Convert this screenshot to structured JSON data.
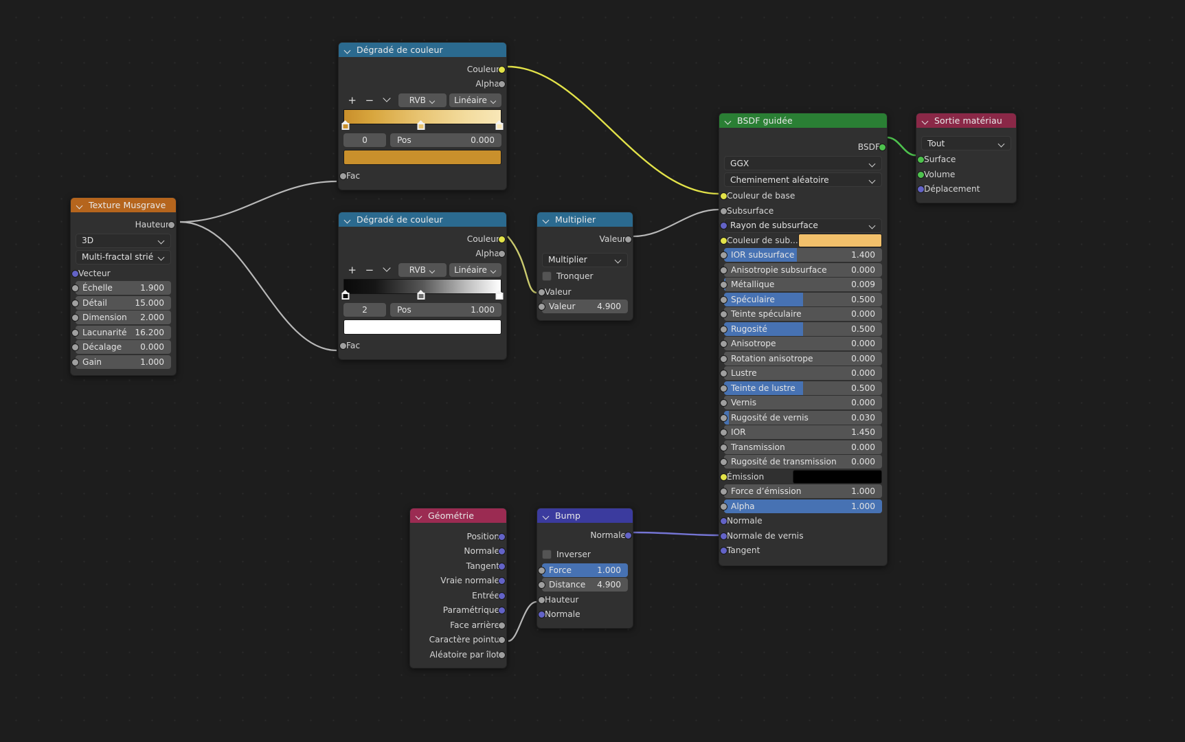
{
  "app": {
    "editor": "blender-shader-node-editor",
    "language": "fr"
  },
  "nodes": {
    "musgrave": {
      "title": "Texture Musgrave",
      "header_color": "#b5651d",
      "outputs": [
        {
          "label": "Hauteur",
          "socket": "gray"
        }
      ],
      "dropdowns": [
        "3D",
        "Multi-fractal strié"
      ],
      "vector_label": "Vecteur",
      "props": [
        {
          "label": "Échelle",
          "value": "1.900"
        },
        {
          "label": "Détail",
          "value": "15.000"
        },
        {
          "label": "Dimension",
          "value": "2.000"
        },
        {
          "label": "Lacunarité",
          "value": "16.200"
        },
        {
          "label": "Décalage",
          "value": "0.000"
        },
        {
          "label": "Gain",
          "value": "1.000"
        }
      ]
    },
    "ramp1": {
      "title": "Dégradé de couleur",
      "header_color": "#2b6a8f",
      "outputs": [
        {
          "label": "Couleur",
          "socket": "yellow"
        },
        {
          "label": "Alpha",
          "socket": "gray"
        }
      ],
      "tools": {
        "add": "+",
        "remove": "−",
        "menu": "chevron-down-icon"
      },
      "interpolation_mode": "RVB",
      "interpolation": "Linéaire",
      "gradient": "linear-gradient(to right, #c98f2b 0%, #d8a63e 18%, #e8c472 48%, #f3dc9e 78%, #f8e7b8 100%)",
      "stops": [
        {
          "pos": 0.0,
          "color": "#c98f2b",
          "selected": true
        },
        {
          "pos": 0.5,
          "color": "#e8c472",
          "selected": false
        },
        {
          "pos": 1.0,
          "color": "#f8e7b8",
          "selected": false
        }
      ],
      "index": "0",
      "pos_label": "Pos",
      "pos_value": "0.000",
      "color_value": "#c9902c",
      "inputs": [
        {
          "label": "Fac",
          "socket": "gray"
        }
      ]
    },
    "ramp2": {
      "title": "Dégradé de couleur",
      "header_color": "#2b6a8f",
      "outputs": [
        {
          "label": "Couleur",
          "socket": "yellow"
        },
        {
          "label": "Alpha",
          "socket": "gray"
        }
      ],
      "tools": {
        "add": "+",
        "remove": "−",
        "menu": "chevron-down-icon"
      },
      "interpolation_mode": "RVB",
      "interpolation": "Linéaire",
      "gradient": "linear-gradient(to right, #0a0a0a 0%, #161616 20%, #575757 50%, #bdbdbd 78%, #ffffff 100%)",
      "stops": [
        {
          "pos": 0.0,
          "color": "#0a0a0a",
          "selected": true
        },
        {
          "pos": 0.5,
          "color": "#6e6e6e",
          "selected": false
        },
        {
          "pos": 1.0,
          "color": "#ffffff",
          "selected": true
        }
      ],
      "index": "2",
      "pos_label": "Pos",
      "pos_value": "1.000",
      "color_value": "#ffffff",
      "inputs": [
        {
          "label": "Fac",
          "socket": "gray"
        }
      ]
    },
    "multiply": {
      "title": "Multiplier",
      "header_color": "#2b6a8f",
      "outputs": [
        {
          "label": "Valeur",
          "socket": "gray"
        }
      ],
      "operation": "Multiplier",
      "clamp_label": "Tronquer",
      "clamp_checked": false,
      "inputs": [
        {
          "label": "Valeur",
          "socket": "gray",
          "value": null
        },
        {
          "label": "Valeur",
          "socket": "gray",
          "value": "4.900"
        }
      ]
    },
    "bsdf": {
      "title": "BSDF guidée",
      "header_color": "#2a7f34",
      "outputs": [
        {
          "label": "BSDF",
          "socket": "green"
        }
      ],
      "dropdowns": [
        "GGX",
        "Cheminement aléatoire"
      ],
      "rows": [
        {
          "label": "Couleur de base",
          "kind": "socket-label",
          "socket": "yellow"
        },
        {
          "label": "Subsurface",
          "kind": "socket-label",
          "socket": "gray"
        },
        {
          "label": "Rayon de subsurface",
          "kind": "dropdown",
          "socket": "violet"
        },
        {
          "label": "Couleur de sub...",
          "kind": "swatch",
          "socket": "yellow",
          "color": "#f2c06b"
        },
        {
          "label": "IOR subsurface",
          "kind": "slider",
          "socket": "gray",
          "value": "1.400",
          "fill": 0.46
        },
        {
          "label": "Anisotropie subsurface",
          "kind": "slider",
          "socket": "gray",
          "value": "0.000",
          "fill": 0
        },
        {
          "label": "Métallique",
          "kind": "slider",
          "socket": "gray",
          "value": "0.009",
          "fill": 0.009
        },
        {
          "label": "Spéculaire",
          "kind": "slider",
          "socket": "gray",
          "value": "0.500",
          "fill": 0.5
        },
        {
          "label": "Teinte spéculaire",
          "kind": "slider",
          "socket": "gray",
          "value": "0.000",
          "fill": 0
        },
        {
          "label": "Rugosité",
          "kind": "slider",
          "socket": "gray",
          "value": "0.500",
          "fill": 0.5
        },
        {
          "label": "Anisotrope",
          "kind": "slider",
          "socket": "gray",
          "value": "0.000",
          "fill": 0
        },
        {
          "label": "Rotation anisotrope",
          "kind": "slider",
          "socket": "gray",
          "value": "0.000",
          "fill": 0
        },
        {
          "label": "Lustre",
          "kind": "slider",
          "socket": "gray",
          "value": "0.000",
          "fill": 0
        },
        {
          "label": "Teinte de lustre",
          "kind": "slider",
          "socket": "gray",
          "value": "0.500",
          "fill": 0.5
        },
        {
          "label": "Vernis",
          "kind": "slider",
          "socket": "gray",
          "value": "0.000",
          "fill": 0
        },
        {
          "label": "Rugosité de vernis",
          "kind": "slider",
          "socket": "gray",
          "value": "0.030",
          "fill": 0.03
        },
        {
          "label": "IOR",
          "kind": "slider",
          "socket": "gray",
          "value": "1.450",
          "fill": 0
        },
        {
          "label": "Transmission",
          "kind": "slider",
          "socket": "gray",
          "value": "0.000",
          "fill": 0
        },
        {
          "label": "Rugosité de transmission",
          "kind": "slider",
          "socket": "gray",
          "value": "0.000",
          "fill": 0
        },
        {
          "label": "Émission",
          "kind": "swatch",
          "socket": "yellow",
          "color": "#000000"
        },
        {
          "label": "Force d’émission",
          "kind": "slider",
          "socket": "gray",
          "value": "1.000",
          "fill": 0
        },
        {
          "label": "Alpha",
          "kind": "slider",
          "socket": "gray",
          "value": "1.000",
          "fill": 1
        },
        {
          "label": "Normale",
          "kind": "socket-label",
          "socket": "violet"
        },
        {
          "label": "Normale de vernis",
          "kind": "socket-label",
          "socket": "violet"
        },
        {
          "label": "Tangent",
          "kind": "socket-label",
          "socket": "violet"
        }
      ]
    },
    "output": {
      "title": "Sortie matériau",
      "header_color": "#8a2847",
      "target": "Tout",
      "inputs": [
        {
          "label": "Surface",
          "socket": "green"
        },
        {
          "label": "Volume",
          "socket": "green"
        },
        {
          "label": "Déplacement",
          "socket": "violet"
        }
      ]
    },
    "geometry": {
      "title": "Géométrie",
      "header_color": "#9b2b52",
      "outputs": [
        {
          "label": "Position",
          "socket": "violet"
        },
        {
          "label": "Normale",
          "socket": "violet"
        },
        {
          "label": "Tangent",
          "socket": "violet"
        },
        {
          "label": "Vraie normale",
          "socket": "violet"
        },
        {
          "label": "Entrée",
          "socket": "violet"
        },
        {
          "label": "Paramétrique",
          "socket": "violet"
        },
        {
          "label": "Face arrière",
          "socket": "gray"
        },
        {
          "label": "Caractère pointu",
          "socket": "gray"
        },
        {
          "label": "Aléatoire par îlot",
          "socket": "gray"
        }
      ]
    },
    "bump": {
      "title": "Bump",
      "header_color": "#3b3b9e",
      "outputs": [
        {
          "label": "Normale",
          "socket": "violet"
        }
      ],
      "invert_label": "Inverser",
      "invert_checked": false,
      "props": [
        {
          "label": "Force",
          "value": "1.000",
          "fill": 1,
          "socket": "gray"
        },
        {
          "label": "Distance",
          "value": "4.900",
          "fill": 0,
          "socket": "gray"
        }
      ],
      "inputs": [
        {
          "label": "Hauteur",
          "socket": "gray"
        },
        {
          "label": "Normale",
          "socket": "violet"
        }
      ]
    }
  },
  "wires": [
    {
      "from": "musgrave.Hauteur",
      "to": "ramp1.Fac",
      "color": "#b8b8b8"
    },
    {
      "from": "musgrave.Hauteur",
      "to": "ramp2.Fac",
      "color": "#b8b8b8"
    },
    {
      "from": "ramp1.Couleur",
      "to": "bsdf.Couleur de base",
      "color": "#e2e249"
    },
    {
      "from": "ramp2.Couleur",
      "to": "multiply.Valeur",
      "color": "#c9c96a"
    },
    {
      "from": "multiply.Valeur",
      "to": "bsdf.Subsurface",
      "color": "#b8b8b8"
    },
    {
      "from": "geometry.Caractère pointu",
      "to": "bump.Hauteur",
      "color": "#b8b8b8"
    },
    {
      "from": "bump.Normale",
      "to": "bsdf.Normale",
      "color": "#7070d0"
    },
    {
      "from": "bsdf.BSDF",
      "to": "output.Surface",
      "color": "#4ec24e"
    }
  ]
}
